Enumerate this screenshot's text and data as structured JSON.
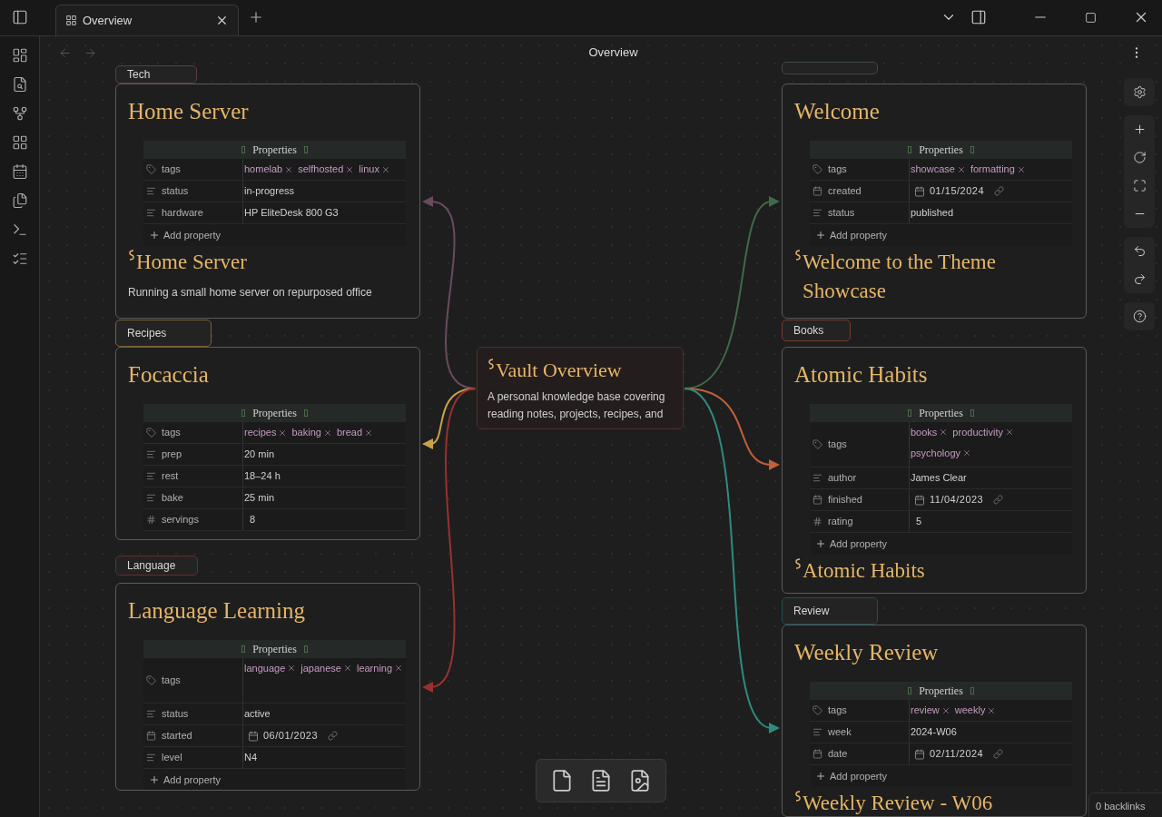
{
  "tab": {
    "title": "Overview",
    "selected": true
  },
  "header": {
    "title": "Overview"
  },
  "cards": [
    {
      "label": {
        "text": "Tech",
        "color": "#5e3a4c"
      },
      "title": "Home Server",
      "properties_title": "Properties",
      "properties": [
        {
          "kind": "tags",
          "name": "tags",
          "tags": [
            "homelab",
            "selfhosted",
            "linux"
          ]
        },
        {
          "kind": "text",
          "name": "status",
          "value": "in-progress"
        },
        {
          "kind": "text",
          "name": "hardware",
          "value": "HP EliteDesk 800 G3"
        }
      ],
      "add_property": "Add property",
      "heading": "Home Server",
      "body": "Running a small home server on repurposed office"
    },
    {
      "label": {
        "color": "#3d4a3e"
      },
      "title": "Welcome",
      "properties_title": "Properties",
      "properties": [
        {
          "kind": "tags",
          "name": "tags",
          "tags": [
            "showcase",
            "formatting"
          ]
        },
        {
          "kind": "date",
          "name": "created",
          "value": "01/15/2024"
        },
        {
          "kind": "text",
          "name": "status",
          "value": "published"
        }
      ],
      "add_property": "Add property",
      "heading": "Welcome to the Theme Showcase"
    },
    {
      "label": {
        "text": "Recipes",
        "color": "#7a6332"
      },
      "title": "Focaccia",
      "properties_title": "Properties",
      "properties": [
        {
          "kind": "tags",
          "name": "tags",
          "tags": [
            "recipes",
            "baking",
            "bread"
          ]
        },
        {
          "kind": "text",
          "name": "prep",
          "value": "20 min"
        },
        {
          "kind": "text",
          "name": "rest",
          "value": "18–24 h"
        },
        {
          "kind": "text",
          "name": "bake",
          "value": "25 min"
        },
        {
          "kind": "number",
          "name": "servings",
          "value": "8"
        }
      ]
    },
    {
      "label": {
        "text": "Books",
        "color": "#7a3a28"
      },
      "title": "Atomic Habits",
      "properties_title": "Properties",
      "properties": [
        {
          "kind": "tags",
          "name": "tags",
          "tags": [
            "books",
            "productivity",
            "psychology"
          ]
        },
        {
          "kind": "text",
          "name": "author",
          "value": "James Clear"
        },
        {
          "kind": "date",
          "name": "finished",
          "value": "11/04/2023"
        },
        {
          "kind": "number",
          "name": "rating",
          "value": "5"
        }
      ],
      "add_property": "Add property",
      "heading": "Atomic Habits"
    },
    {
      "label": {
        "text": "Language",
        "color": "#6a2a2a"
      },
      "title": "Language Learning",
      "properties_title": "Properties",
      "properties": [
        {
          "kind": "tags",
          "name": "tags",
          "tags": [
            "language",
            "japanese",
            "learning"
          ]
        },
        {
          "kind": "text",
          "name": "status",
          "value": "active"
        },
        {
          "kind": "date",
          "name": "started",
          "value": "06/01/2023"
        },
        {
          "kind": "text",
          "name": "level",
          "value": "N4"
        }
      ],
      "add_property": "Add property"
    },
    {
      "label": {
        "text": "Review",
        "color": "#1f5050"
      },
      "title": "Weekly Review",
      "properties_title": "Properties",
      "properties": [
        {
          "kind": "tags",
          "name": "tags",
          "tags": [
            "review",
            "weekly"
          ]
        },
        {
          "kind": "text",
          "name": "week",
          "value": "2024-W06"
        },
        {
          "kind": "date",
          "name": "date",
          "value": "02/11/2024"
        }
      ],
      "add_property": "Add property",
      "heading": "Weekly Review - W06"
    }
  ],
  "vault": {
    "title": "Vault Overview",
    "body": "A personal knowledge base covering reading notes, projects, recipes, and"
  },
  "edges": [
    {
      "color": "#6a4a5e"
    },
    {
      "color": "#3f6a48"
    },
    {
      "color": "#c9a24a"
    },
    {
      "color": "#c0603a"
    },
    {
      "color": "#9a3030"
    },
    {
      "color": "#2f8a80"
    }
  ],
  "backlinks": "0 backlinks"
}
